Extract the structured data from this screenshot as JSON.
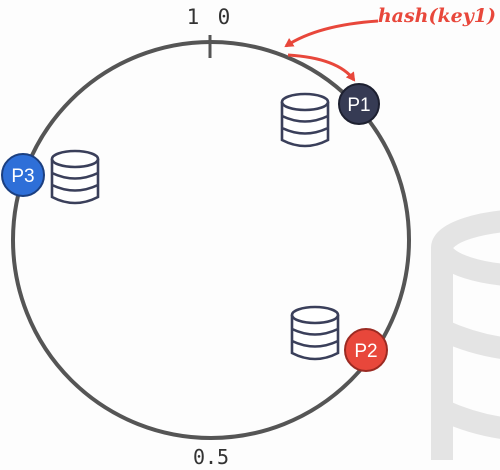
{
  "ring": {
    "top_label_left": "1",
    "top_label_right": "0",
    "bottom_label": "0.5"
  },
  "hash_label": "hash(key1)",
  "nodes": [
    {
      "label": "P1",
      "color": "#363b54"
    },
    {
      "label": "P2",
      "color": "#e8473b"
    },
    {
      "label": "P3",
      "color": "#2e6fd8"
    }
  ],
  "colors": {
    "ring": "#555555",
    "arrow": "#e8473b",
    "database": "#3a3f5a",
    "background": "#fdfdfd",
    "faded_database": "#e7e7e7"
  },
  "icons": {
    "database": "database-icon",
    "faded_background": "faded-database-icon"
  }
}
